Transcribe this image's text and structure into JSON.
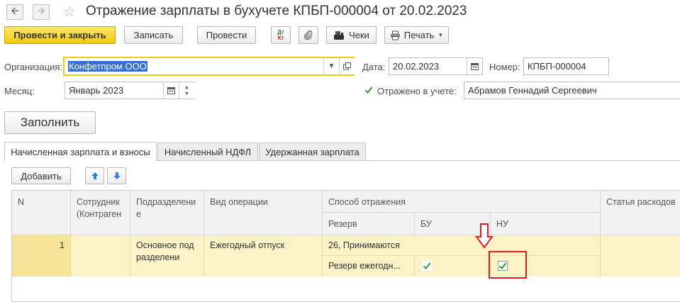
{
  "nav": {
    "back_icon": "arrow-left-icon",
    "forward_icon": "arrow-right-icon",
    "favorite_icon": "star-icon"
  },
  "window": {
    "title": "Отражение зарплаты в бухучете КПБП-000004 от 20.02.2023"
  },
  "toolbar": {
    "post_close_label": "Провести и закрыть",
    "save_label": "Записать",
    "post_label": "Провести",
    "dtkt_dt": "Дт",
    "dtkt_kt": "Кт",
    "checks_label": "Чеки",
    "print_label": "Печать"
  },
  "form": {
    "org_label": "Организация:",
    "org_value": "Конфетпром ООО",
    "date_label": "Дата:",
    "date_value": "20.02.2023",
    "number_label": "Номер:",
    "number_value": "КПБП-000004",
    "month_label": "Месяц:",
    "month_value": "Январь 2023",
    "reflected_label": "Отражено в учете:",
    "reflected_checked": true,
    "responsible_value": "Абрамов Геннадий Сергеевич"
  },
  "fill_button": "Заполнить",
  "tabs": [
    {
      "label": "Начисленная зарплата и взносы",
      "active": true
    },
    {
      "label": "Начисленный НДФЛ",
      "active": false
    },
    {
      "label": "Удержанная зарплата",
      "active": false
    }
  ],
  "table_toolbar": {
    "add_label": "Добавить"
  },
  "table": {
    "headers": {
      "n": "N",
      "employee": "Сотрудник (Контраген",
      "department": "Подразделение",
      "operation": "Вид операции",
      "method": "Способ отражения",
      "reserve": "Резерв",
      "bu": "БУ",
      "nu": "НУ",
      "expense": "Статья расходов"
    },
    "rows": [
      {
        "n": "1",
        "employee": "",
        "department": "Основное подразделени",
        "operation": "Ежегодный отпуск",
        "method": "26, Принимаются",
        "reserve": "Резерв ежегодн...",
        "bu_checked": true,
        "nu_checked": true
      }
    ]
  },
  "colors": {
    "accent": "#f2c90c",
    "check": "#2e9b3e",
    "highlight": "#e02020",
    "row": "#fbf2c7"
  }
}
